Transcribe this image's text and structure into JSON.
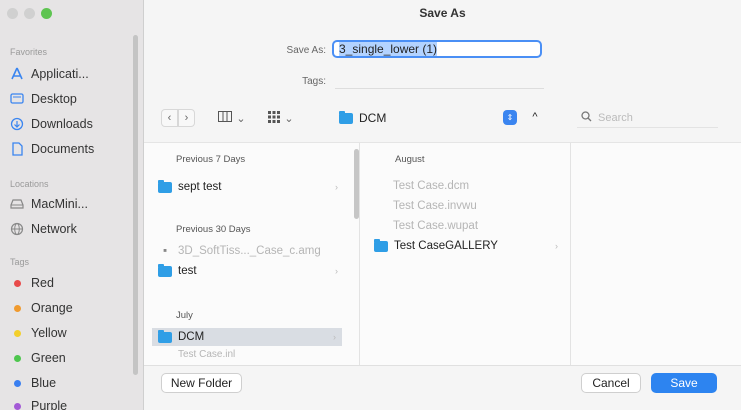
{
  "window": {
    "title": "Save As"
  },
  "form": {
    "save_as_label": "Save As:",
    "save_as_value": "3_single_lower (1)",
    "tags_label": "Tags:"
  },
  "toolbar": {
    "location": "DCM",
    "search_placeholder": "Search"
  },
  "sidebar": {
    "favorites_header": "Favorites",
    "favorites": [
      {
        "label": "Applicati...",
        "icon": "applications-icon"
      },
      {
        "label": "Desktop",
        "icon": "desktop-icon"
      },
      {
        "label": "Downloads",
        "icon": "downloads-icon"
      },
      {
        "label": "Documents",
        "icon": "documents-icon"
      }
    ],
    "locations_header": "Locations",
    "locations": [
      {
        "label": "MacMini...",
        "icon": "drive-icon"
      },
      {
        "label": "Network",
        "icon": "network-icon"
      }
    ],
    "tags_header": "Tags",
    "tags": [
      {
        "label": "Red",
        "color": "#e84a4a"
      },
      {
        "label": "Orange",
        "color": "#f09a2e"
      },
      {
        "label": "Yellow",
        "color": "#f3cf2b"
      },
      {
        "label": "Green",
        "color": "#4ec64e"
      },
      {
        "label": "Blue",
        "color": "#3a7ff0"
      },
      {
        "label": "Purple",
        "color": "#a35ad6"
      }
    ]
  },
  "browser": {
    "col1": {
      "sections": [
        {
          "header": "Previous 7 Days",
          "items": [
            {
              "name": "sept test",
              "type": "folder"
            }
          ]
        },
        {
          "header": "Previous 30 Days",
          "items": [
            {
              "name": "3D_SoftTiss..._Case_c.amg",
              "type": "file"
            },
            {
              "name": "test",
              "type": "folder"
            }
          ]
        },
        {
          "header": "July",
          "items": [
            {
              "name": "DCM",
              "type": "folder",
              "selected": true
            },
            {
              "name": "Test Case.inl",
              "type": "file"
            }
          ]
        }
      ]
    },
    "col2": {
      "header": "August",
      "items": [
        {
          "name": "Test Case.dcm",
          "type": "file"
        },
        {
          "name": "Test Case.invwu",
          "type": "file"
        },
        {
          "name": "Test Case.wupat",
          "type": "file"
        },
        {
          "name": "Test CaseGALLERY",
          "type": "folder"
        }
      ]
    }
  },
  "footer": {
    "new_folder": "New Folder",
    "cancel": "Cancel",
    "save": "Save"
  },
  "colors": {
    "accent": "#2d84f0",
    "folder": "#2f9ee6"
  }
}
